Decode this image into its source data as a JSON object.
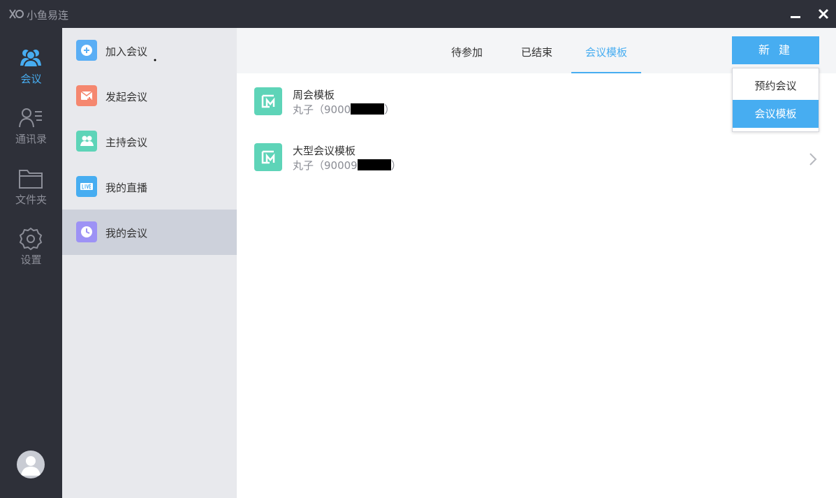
{
  "app": {
    "title": "小鱼易连"
  },
  "nav": {
    "items": [
      {
        "label": "会议",
        "icon": "users-icon",
        "active": true
      },
      {
        "label": "通讯录",
        "icon": "contacts-icon",
        "active": false
      },
      {
        "label": "文件夹",
        "icon": "folder-icon",
        "active": false
      },
      {
        "label": "设置",
        "icon": "gear-icon",
        "active": false
      }
    ]
  },
  "submenu": {
    "items": [
      {
        "label": "加入会议",
        "icon": "plus-circle-icon",
        "color": "#5aaef5"
      },
      {
        "label": "发起会议",
        "icon": "start-meeting-icon",
        "color": "#f5876f"
      },
      {
        "label": "主持会议",
        "icon": "host-meeting-icon",
        "color": "#5ed4b8"
      },
      {
        "label": "我的直播",
        "icon": "live-icon",
        "color": "#47adf1"
      },
      {
        "label": "我的会议",
        "icon": "clock-icon",
        "color": "#9d92f5",
        "active": true
      }
    ]
  },
  "tabs": [
    {
      "label": "待参加"
    },
    {
      "label": "已结束"
    },
    {
      "label": "会议模板",
      "active": true
    }
  ],
  "toolbar": {
    "new_label": "新 建"
  },
  "dropdown": {
    "items": [
      {
        "label": "预约会议"
      },
      {
        "label": "会议模板",
        "selected": true
      }
    ]
  },
  "templates": [
    {
      "name": "周会模板",
      "owner_prefix": "丸子（9000",
      "owner_suffix": "）"
    },
    {
      "name": "大型会议模板",
      "owner_prefix": "丸子（90009",
      "owner_suffix": "）"
    }
  ],
  "colors": {
    "accent": "#47adf1",
    "sidebar_bg": "#2e3039",
    "submenu_bg": "#e8e9ed",
    "template_icon": "#5ed4b8"
  }
}
